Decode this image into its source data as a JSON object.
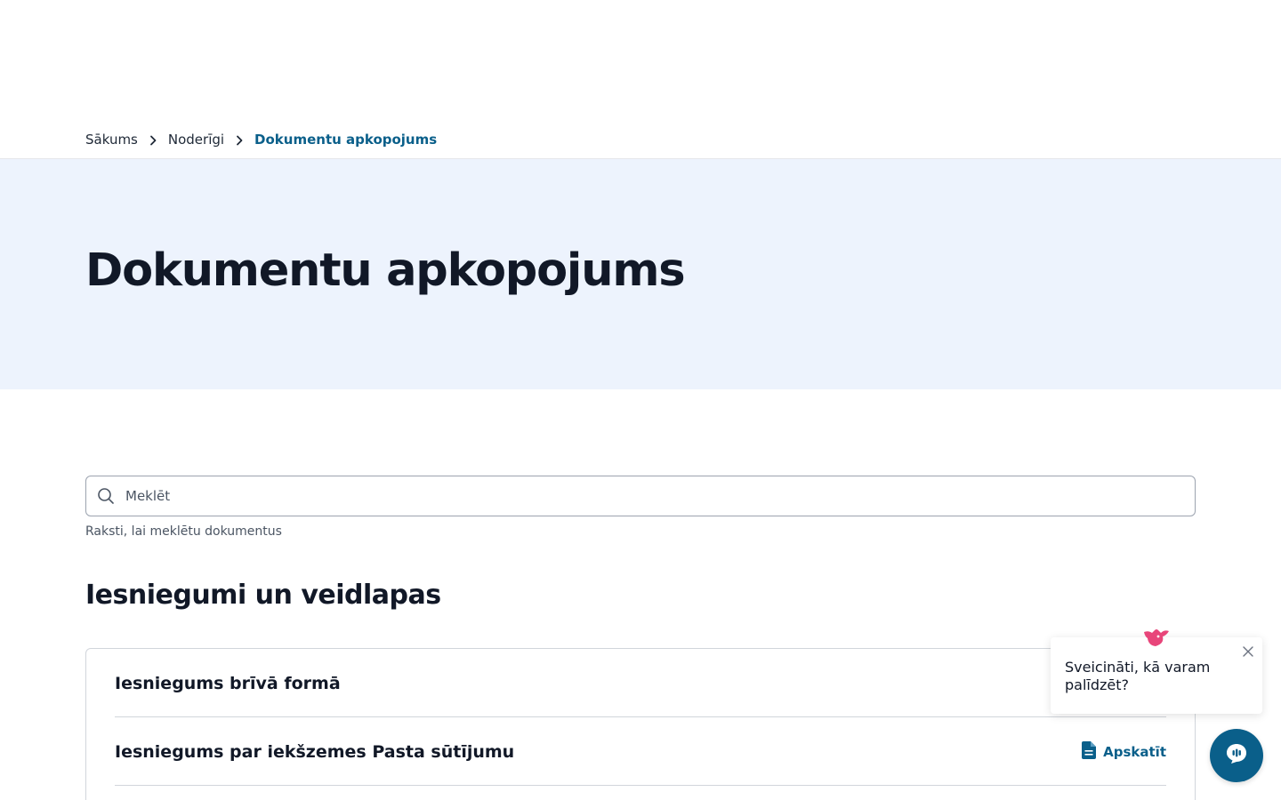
{
  "breadcrumb": {
    "home": "Sākums",
    "parent": "Noderīgi",
    "current": "Dokumentu apkopojums"
  },
  "hero": {
    "title": "Dokumentu apkopojums"
  },
  "search": {
    "placeholder": "Meklēt",
    "helper": "Raksti, lai meklētu dokumentus"
  },
  "section": {
    "title": "Iesniegumi un veidlapas"
  },
  "documents": [
    {
      "title": "Iesniegums brīvā formā",
      "action_label": ""
    },
    {
      "title": "Iesniegums par iekšzemes Pasta sūtījumu",
      "action_label": "Apskatīt"
    }
  ],
  "chat": {
    "greeting": "Sveicināti, kā varam palīdzēt?"
  },
  "colors": {
    "accent": "#0a5f8a",
    "hero_bg": "#edf3fd",
    "mascot": "#e8457a"
  },
  "icons": {
    "search": "search-icon",
    "chevron": "chevron-right-icon",
    "document": "document-icon",
    "close": "close-icon",
    "chat": "chat-icon",
    "mascot": "bird-icon"
  }
}
